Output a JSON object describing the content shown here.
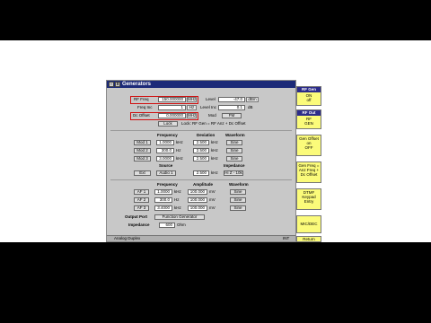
{
  "window": {
    "title": "Generators"
  },
  "rf": {
    "freq_label": "RF Freq",
    "freq_value": "150.000000",
    "freq_unit": "MHz",
    "level_label": "Level",
    "level_value": "-47.0",
    "level_unit": "dBm",
    "freq_inc_label": "Freq Inc",
    "freq_inc_value": "1",
    "freq_inc_unit": "Hz",
    "level_inc_label": "Level Inc",
    "level_inc_value": "0.1",
    "level_inc_unit": "dB",
    "dc_offset_label": "Dc Offset",
    "dc_offset_value": "0.000000",
    "dc_offset_unit": "MHz",
    "mod_label": "Mod",
    "mod_value": "FM",
    "lock_button": "Lock",
    "lock_text": "Lock: RF Gen = RF Anz + Dc Offset"
  },
  "mod_section": {
    "headers": {
      "frequency": "Frequency",
      "deviation": "Deviation",
      "waveform": "Waveform"
    },
    "rows": [
      {
        "button": "Mod 1",
        "freq": "1.0000",
        "freq_unit": "kHz",
        "dev": "2.500",
        "dev_unit": "kHz",
        "wave": "Sine"
      },
      {
        "button": "Mod 2",
        "freq": "300.0",
        "freq_unit": "Hz",
        "dev": "2.500",
        "dev_unit": "kHz",
        "wave": "Sine"
      },
      {
        "button": "Mod 3",
        "freq": "3.0000",
        "freq_unit": "kHz",
        "dev": "2.500",
        "dev_unit": "kHz",
        "wave": "Sine"
      }
    ],
    "source_header": "Source",
    "impedance_header": "Impedance",
    "ext": {
      "button": "Ext",
      "source": "Audio 1",
      "dev": "2.500",
      "dev_unit": "kHz",
      "impedance": "Hi Z - 10k"
    }
  },
  "af_section": {
    "headers": {
      "frequency": "Frequency",
      "amplitude": "Amplitude",
      "waveform": "Waveform"
    },
    "rows": [
      {
        "button": "AF 1",
        "freq": "1.0000",
        "freq_unit": "kHz",
        "amp": "100.000",
        "amp_unit": "mV",
        "wave": "Sine"
      },
      {
        "button": "AF 2",
        "freq": "300.0",
        "freq_unit": "Hz",
        "amp": "100.000",
        "amp_unit": "mV",
        "wave": "Sine"
      },
      {
        "button": "AF 3",
        "freq": "3.4000",
        "freq_unit": "kHz",
        "amp": "100.000",
        "amp_unit": "mV",
        "wave": "Sine"
      }
    ],
    "output_port_label": "Output Port",
    "output_port_value": "Function Generator",
    "impedance_label": "Impedance",
    "impedance_value": "600",
    "impedance_unit": "Ohm"
  },
  "status": {
    "left": "Analog Duplex",
    "right": "INT"
  },
  "softkeys": [
    {
      "header": "RF Gen",
      "lines": [
        "ON",
        "off"
      ]
    },
    {
      "header": "RF Out",
      "lines": [
        "RF",
        "GEN"
      ]
    },
    {
      "header": "",
      "lines": [
        "Gen Offset",
        "on",
        "OFF"
      ]
    },
    {
      "header": "",
      "lines": [
        "Gen Freq =",
        "Anz Freq +",
        "Dc Offset"
      ]
    },
    {
      "header": "",
      "lines": [
        "DTMF",
        "Keypad",
        "Entry"
      ]
    },
    {
      "header": "",
      "lines": [
        "MIC/DEC"
      ]
    },
    {
      "header": "",
      "lines": [
        "Return"
      ]
    }
  ],
  "colors": {
    "title_bar": "#1c2a78",
    "softkey": "#fbfb7a",
    "highlight": "#d01010",
    "arrow": "#c81010"
  }
}
